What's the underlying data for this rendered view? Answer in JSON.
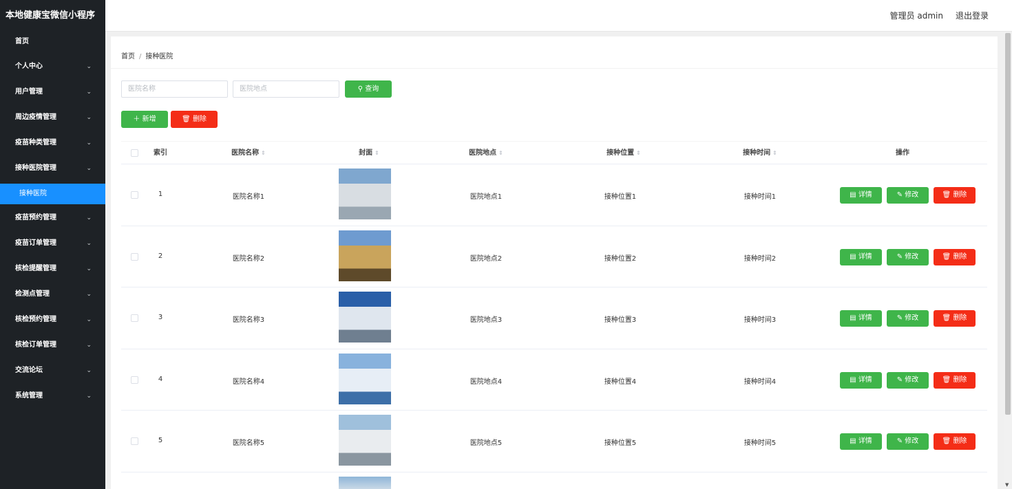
{
  "app": {
    "title": "本地健康宝微信小程序",
    "user_label": "管理员 admin",
    "logout_label": "退出登录"
  },
  "sidebar": {
    "home": "首页",
    "items": [
      {
        "label": "个人中心"
      },
      {
        "label": "用户管理"
      },
      {
        "label": "周边疫情管理"
      },
      {
        "label": "疫苗种类管理"
      },
      {
        "label": "接种医院管理"
      }
    ],
    "active_sub": "接种医院",
    "items_after": [
      {
        "label": "疫苗预约管理"
      },
      {
        "label": "疫苗订单管理"
      },
      {
        "label": "核检提醒管理"
      },
      {
        "label": "检测点管理"
      },
      {
        "label": "核检预约管理"
      },
      {
        "label": "核检订单管理"
      },
      {
        "label": "交流论坛"
      },
      {
        "label": "系统管理"
      }
    ],
    "chevron": "chevron-down-icon"
  },
  "breadcrumb": {
    "home": "首页",
    "separator": "/",
    "current": "接种医院"
  },
  "search": {
    "name_placeholder": "医院名称",
    "location_placeholder": "医院地点",
    "query_label": "查询"
  },
  "toolbar": {
    "add_label": "新增",
    "delete_label": "删除"
  },
  "table": {
    "headers": {
      "index": "索引",
      "name": "医院名称",
      "cover": "封面",
      "location": "医院地点",
      "position": "接种位置",
      "time": "接种时间",
      "actions": "操作"
    },
    "rows": [
      {
        "index": "1",
        "name": "医院名称1",
        "location": "医院地点1",
        "position": "接种位置1",
        "time": "接种时间1"
      },
      {
        "index": "2",
        "name": "医院名称2",
        "location": "医院地点2",
        "position": "接种位置2",
        "time": "接种时间2"
      },
      {
        "index": "3",
        "name": "医院名称3",
        "location": "医院地点3",
        "position": "接种位置3",
        "time": "接种时间3"
      },
      {
        "index": "4",
        "name": "医院名称4",
        "location": "医院地点4",
        "position": "接种位置4",
        "time": "接种时间4"
      },
      {
        "index": "5",
        "name": "医院名称5",
        "location": "医院地点5",
        "position": "接种位置5",
        "time": "接种时间5"
      }
    ],
    "row_actions": {
      "detail": "详情",
      "edit": "修改",
      "delete": "删除"
    }
  },
  "colors": {
    "sidebar_bg": "#1e2226",
    "active": "#1890ff",
    "green": "#3fb54a",
    "red": "#f42d17"
  }
}
